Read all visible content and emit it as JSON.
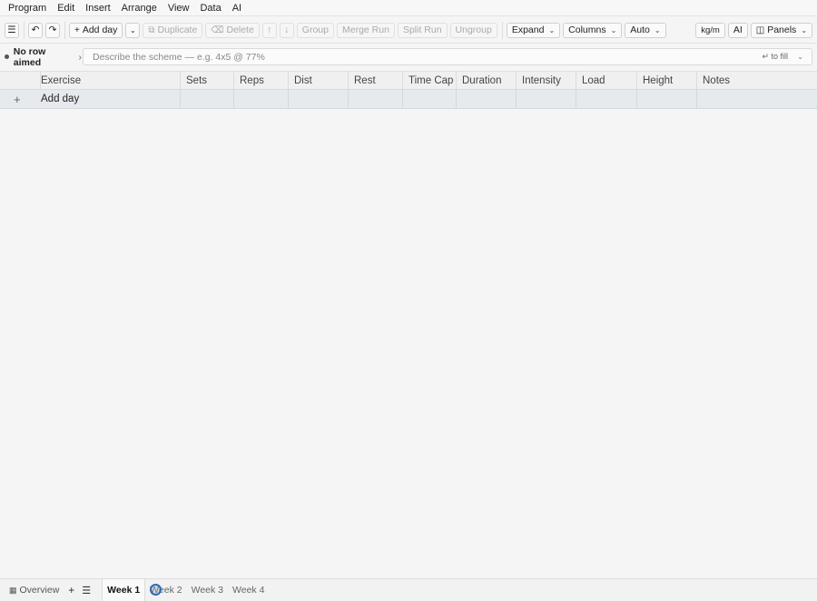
{
  "menu": [
    "Program",
    "Edit",
    "Insert",
    "Arrange",
    "View",
    "Data",
    "AI"
  ],
  "toolbar": {
    "menu_icon": "hamburger-icon",
    "undo_icon": "undo-icon",
    "redo_icon": "redo-icon",
    "add_day": "Add day",
    "duplicate": "Duplicate",
    "delete": "Delete",
    "group": "Group",
    "merge_run": "Merge Run",
    "split_run": "Split Run",
    "ungroup": "Ungroup",
    "expand": "Expand",
    "columns": "Columns",
    "auto": "Auto",
    "units": "kg/m",
    "ai": "AI",
    "panels": "Panels"
  },
  "command": {
    "aimed_status": "No row aimed",
    "placeholder": "Describe the scheme — e.g. 4x5 @ 77%",
    "hint": "↵ to fill"
  },
  "columns": [
    "Exercise",
    "Sets",
    "Reps",
    "Dist",
    "Rest",
    "Time Cap",
    "Duration",
    "Intensity",
    "Load",
    "Height",
    "Notes"
  ],
  "rows": [
    {
      "label": "Add day"
    }
  ],
  "bottom": {
    "overview": "Overview",
    "weeks": [
      "Week 1",
      "Week 2",
      "Week 3",
      "Week 4"
    ],
    "active_week": "Week 1"
  }
}
